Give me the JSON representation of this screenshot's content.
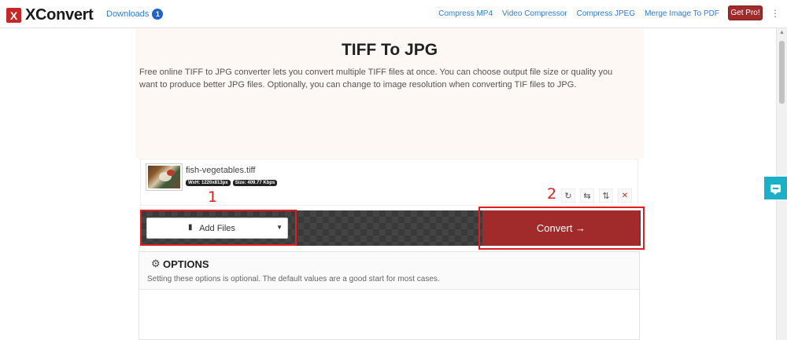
{
  "navbar": {
    "brand_letter": "X",
    "brand_name": "XConvert",
    "downloads_label": "Downloads",
    "downloads_count": "1",
    "links": [
      "Compress MP4",
      "Video Compressor",
      "Compress JPEG",
      "Merge Image To PDF"
    ],
    "get_pro": "Get Pro!",
    "menu_glyph": "⋮"
  },
  "hero": {
    "title": "TIFF To JPG",
    "description": "Free online TIFF to JPG converter lets you convert multiple TIFF files at once. You can choose output file size or quality you want to produce better JPG files. Optionally, you can change to image resolution when converting TIF files to JPG."
  },
  "file": {
    "name": "fish-vegetables.tiff",
    "dimensions_tag": "WxH: 1220x813px",
    "size_tag": "Size: 409.77 Kbps",
    "actions": [
      "rotate",
      "flip-horizontal",
      "flip-vertical",
      "remove"
    ]
  },
  "annotations": {
    "step1": "1",
    "step2": "2"
  },
  "controls": {
    "add_files": "Add Files",
    "convert": "Convert →"
  },
  "options": {
    "title": "OPTIONS",
    "description": "Setting these options is optional. The default values are a good start for most cases."
  },
  "colors": {
    "brand_red": "#a12a2a",
    "link_blue": "#2e7bd6",
    "annotation_red": "#e02020",
    "chat_teal": "#1ab1c8"
  }
}
